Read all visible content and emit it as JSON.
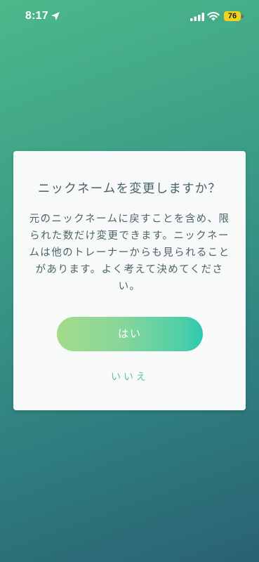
{
  "status_bar": {
    "time": "8:17",
    "battery_level": "76",
    "icons": [
      "location-arrow-icon",
      "cellular-signal-icon",
      "wifi-icon",
      "battery-icon"
    ]
  },
  "dialog": {
    "title": "ニックネームを変更しますか？",
    "message": "元のニックネームに戻すことを含め、限られた数だけ変更できます。ニックネームは他のトレーナーからも見られることがあります。よく考えて決めてください。",
    "confirm_label": "はい",
    "cancel_label": "いいえ"
  },
  "colors": {
    "background_top": "#4cb88a",
    "background_bottom": "#2a6273",
    "dialog_text": "#48636a",
    "confirm_gradient_start": "#a5db8a",
    "confirm_gradient_end": "#2ec8b0",
    "cancel_text": "#5cc39a",
    "battery": "#f2d31b"
  }
}
